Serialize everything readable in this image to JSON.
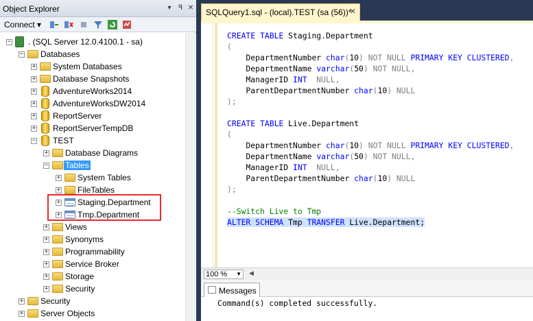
{
  "object_explorer": {
    "title": "Object Explorer",
    "pin_glyph": "▾ ꟼ ✕",
    "connect_label": "Connect ▾",
    "tree": [
      {
        "label": ". (SQL Server 12.0.4100.1 - sa)",
        "level": 0,
        "expander": "−",
        "icon": "server-icon"
      },
      {
        "label": "Databases",
        "level": 1,
        "expander": "−",
        "icon": "folder-icon"
      },
      {
        "label": "System Databases",
        "level": 2,
        "expander": "+",
        "icon": "folder-icon"
      },
      {
        "label": "Database Snapshots",
        "level": 2,
        "expander": "+",
        "icon": "folder-icon"
      },
      {
        "label": "AdventureWorks2014",
        "level": 2,
        "expander": "+",
        "icon": "database-icon"
      },
      {
        "label": "AdventureWorksDW2014",
        "level": 2,
        "expander": "+",
        "icon": "database-icon"
      },
      {
        "label": "ReportServer",
        "level": 2,
        "expander": "+",
        "icon": "database-icon"
      },
      {
        "label": "ReportServerTempDB",
        "level": 2,
        "expander": "+",
        "icon": "database-icon"
      },
      {
        "label": "TEST",
        "level": 2,
        "expander": "−",
        "icon": "database-icon"
      },
      {
        "label": "Database Diagrams",
        "level": 3,
        "expander": "+",
        "icon": "folder-icon"
      },
      {
        "label": "Tables",
        "level": 3,
        "expander": "−",
        "icon": "folder-icon",
        "selected": true
      },
      {
        "label": "System Tables",
        "level": 4,
        "expander": "+",
        "icon": "folder-icon"
      },
      {
        "label": "FileTables",
        "level": 4,
        "expander": "+",
        "icon": "folder-icon"
      },
      {
        "label": "Staging.Department",
        "level": 4,
        "expander": "+",
        "icon": "table-icon"
      },
      {
        "label": "Tmp.Department",
        "level": 4,
        "expander": "+",
        "icon": "table-icon"
      },
      {
        "label": "Views",
        "level": 3,
        "expander": "+",
        "icon": "folder-icon"
      },
      {
        "label": "Synonyms",
        "level": 3,
        "expander": "+",
        "icon": "folder-icon"
      },
      {
        "label": "Programmability",
        "level": 3,
        "expander": "+",
        "icon": "folder-icon"
      },
      {
        "label": "Service Broker",
        "level": 3,
        "expander": "+",
        "icon": "folder-icon"
      },
      {
        "label": "Storage",
        "level": 3,
        "expander": "+",
        "icon": "folder-icon"
      },
      {
        "label": "Security",
        "level": 3,
        "expander": "+",
        "icon": "folder-icon"
      },
      {
        "label": "Security",
        "level": 1,
        "expander": "+",
        "icon": "folder-icon"
      },
      {
        "label": "Server Objects",
        "level": 1,
        "expander": "+",
        "icon": "folder-icon"
      }
    ]
  },
  "editor": {
    "tab_title": "SQLQuery1.sql - (local).TEST (sa (56))*",
    "tab_close": "✕",
    "code_lines": [
      [
        {
          "c": "kw",
          "t": "CREATE TABLE "
        },
        {
          "c": "",
          "t": "Staging.Department"
        }
      ],
      [
        {
          "c": "gr",
          "t": "("
        }
      ],
      [
        {
          "c": "",
          "t": "    DepartmentNumber "
        },
        {
          "c": "kw",
          "t": "char"
        },
        {
          "c": "gr",
          "t": "("
        },
        {
          "c": "",
          "t": "10"
        },
        {
          "c": "gr",
          "t": ") NOT NULL "
        },
        {
          "c": "kw",
          "t": "PRIMARY KEY CLUSTERED"
        },
        {
          "c": "gr",
          "t": ","
        }
      ],
      [
        {
          "c": "",
          "t": "    DepartmentName "
        },
        {
          "c": "kw",
          "t": "varchar"
        },
        {
          "c": "gr",
          "t": "("
        },
        {
          "c": "",
          "t": "50"
        },
        {
          "c": "gr",
          "t": ") NOT NULL,"
        }
      ],
      [
        {
          "c": "",
          "t": "    ManagerID "
        },
        {
          "c": "kw",
          "t": "INT"
        },
        {
          "c": "gr",
          "t": "  NULL,"
        }
      ],
      [
        {
          "c": "",
          "t": "    ParentDepartmentNumber "
        },
        {
          "c": "kw",
          "t": "char"
        },
        {
          "c": "gr",
          "t": "("
        },
        {
          "c": "",
          "t": "10"
        },
        {
          "c": "gr",
          "t": ") NULL"
        }
      ],
      [
        {
          "c": "gr",
          "t": ");"
        }
      ],
      [],
      [
        {
          "c": "kw",
          "t": "CREATE TABLE "
        },
        {
          "c": "",
          "t": "Live.Department"
        }
      ],
      [
        {
          "c": "gr",
          "t": "("
        }
      ],
      [
        {
          "c": "",
          "t": "    DepartmentNumber "
        },
        {
          "c": "kw",
          "t": "char"
        },
        {
          "c": "gr",
          "t": "("
        },
        {
          "c": "",
          "t": "10"
        },
        {
          "c": "gr",
          "t": ") NOT NULL "
        },
        {
          "c": "kw",
          "t": "PRIMARY KEY CLUSTERED"
        },
        {
          "c": "gr",
          "t": ","
        }
      ],
      [
        {
          "c": "",
          "t": "    DepartmentName "
        },
        {
          "c": "kw",
          "t": "varchar"
        },
        {
          "c": "gr",
          "t": "("
        },
        {
          "c": "",
          "t": "50"
        },
        {
          "c": "gr",
          "t": ") NOT NULL,"
        }
      ],
      [
        {
          "c": "",
          "t": "    ManagerID "
        },
        {
          "c": "kw",
          "t": "INT"
        },
        {
          "c": "gr",
          "t": "  NULL,"
        }
      ],
      [
        {
          "c": "",
          "t": "    ParentDepartmentNumber "
        },
        {
          "c": "kw",
          "t": "char"
        },
        {
          "c": "gr",
          "t": "("
        },
        {
          "c": "",
          "t": "10"
        },
        {
          "c": "gr",
          "t": ") NULL"
        }
      ],
      [
        {
          "c": "gr",
          "t": ");"
        }
      ],
      [],
      [
        {
          "c": "cm",
          "t": "--Switch Live to Tmp"
        }
      ],
      [
        {
          "c": "kw",
          "t": "ALTER SCHEMA "
        },
        {
          "c": "",
          "t": "Tmp "
        },
        {
          "c": "kw",
          "t": "TRANSFER "
        },
        {
          "c": "",
          "t": "Live.Department;"
        }
      ]
    ],
    "zoom_value": "100 %",
    "results_tab_label": "Messages",
    "result_message": "Command(s) completed successfully."
  },
  "colors": {
    "keyword": "#0000ff",
    "operator": "#808080",
    "comment": "#008000",
    "selection": "#3399ff",
    "highlight_box": "#e8282c",
    "chrome": "#293955"
  }
}
